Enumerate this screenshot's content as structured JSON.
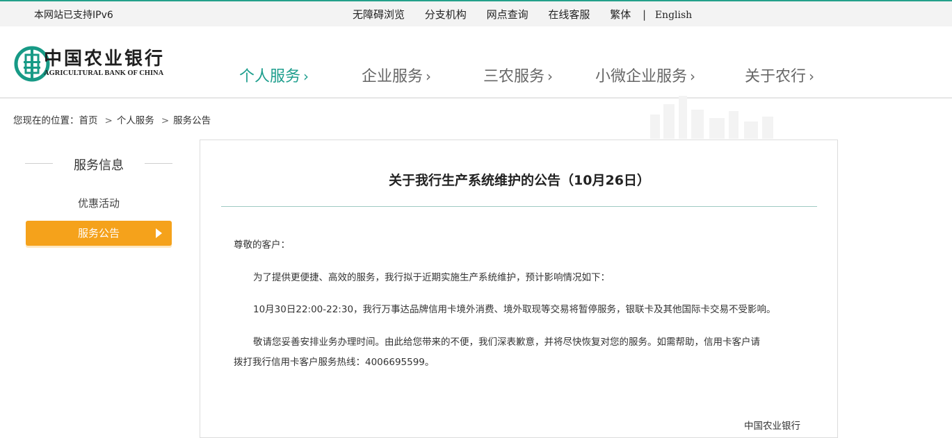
{
  "topbar": {
    "ipv6_notice": "本网站已支持IPv6",
    "links": [
      "无障碍浏览",
      "分支机构",
      "网点查询",
      "在线客服",
      "繁体"
    ],
    "separator": "|",
    "english": "English"
  },
  "header": {
    "logo_cn": "中国农业银行",
    "logo_en": "AGRICULTURAL BANK OF CHINA",
    "nav": [
      {
        "label": "个人服务",
        "active": true
      },
      {
        "label": "企业服务",
        "active": false
      },
      {
        "label": "三农服务",
        "active": false
      },
      {
        "label": "小微企业服务",
        "active": false
      },
      {
        "label": "关于农行",
        "active": false
      }
    ],
    "nav_chevron": "›"
  },
  "breadcrumb": {
    "prefix": "您现在的位置：",
    "items": [
      "首页",
      "个人服务",
      "服务公告"
    ],
    "separator": ">"
  },
  "sidebar": {
    "title": "服务信息",
    "items": [
      {
        "label": "优惠活动",
        "active": false
      },
      {
        "label": "服务公告",
        "active": true
      }
    ]
  },
  "article": {
    "title": "关于我行生产系统维护的公告（10月26日）",
    "salutation": "尊敬的客户：",
    "para1": "为了提供更便捷、高效的服务，我行拟于近期实施生产系统维护，预计影响情况如下：",
    "para2": "10月30日22:00-22:30，我行万事达品牌信用卡境外消费、境外取现等交易将暂停服务，银联卡及其他国际卡交易不受影响。",
    "para3_line1": "敬请您妥善安排业务办理时间。由此给您带来的不便，我们深表歉意，并将尽快恢复对您的服务。如需帮助，信用卡客户请",
    "para3_line2": "拨打我行信用卡客户服务热线：4006695599。",
    "signature": "中国农业银行"
  },
  "colors": {
    "accent": "#1d9e8d",
    "active_tab": "#f5a21b",
    "topbar_border": "#24a08a"
  }
}
